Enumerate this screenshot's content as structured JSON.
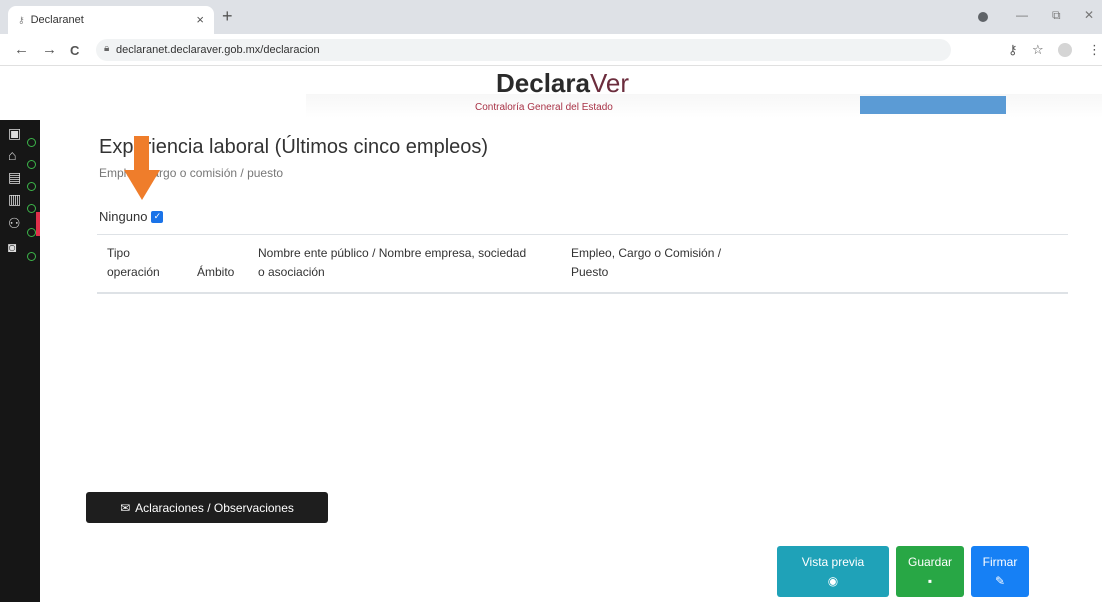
{
  "browser": {
    "tab_title": "Declaranet",
    "tab_close": "×",
    "new_tab": "+",
    "url": "declaranet.declaraver.gob.mx/declaracion",
    "nav_back": "←",
    "nav_forward": "→",
    "nav_reload": "C",
    "key_icon": "⚷",
    "star_icon": "☆",
    "menu_icon": "⋮",
    "min": "—",
    "restore": "⧉",
    "close": "✕"
  },
  "header": {
    "brand_bold": "Declara",
    "brand_light": "Ver",
    "subtitle": "Contraloría General del Estado"
  },
  "section": {
    "title": "Experiencia laboral (Últimos cinco empleos)",
    "subtitle": "Empleo, cargo o comisión / puesto",
    "ninguno_label": "Ninguno",
    "ninguno_checked": true
  },
  "table": {
    "headers": [
      "Tipo operación",
      "Ámbito",
      "Nombre ente público / Nombre empresa, sociedad o asociación",
      "Empleo, Cargo o Comisión / Puesto"
    ],
    "header_lines": [
      [
        "Tipo",
        "operación"
      ],
      [
        "",
        "Ámbito"
      ],
      [
        "Nombre ente público / Nombre empresa, sociedad",
        "o asociación"
      ],
      [
        "Empleo, Cargo o Comisión /",
        "Puesto"
      ]
    ],
    "rows": []
  },
  "buttons": {
    "aclaraciones": "Aclaraciones / Observaciones",
    "vista_previa": "Vista previa",
    "guardar": "Guardar",
    "firmar": "Firmar"
  },
  "colors": {
    "sidebar": "#161616",
    "brand_accent": "#a83246",
    "vista_previa": "#1fa2b8",
    "guardar": "#28a745",
    "firmar": "#1680f5",
    "arrow": "#ef7d2b"
  }
}
